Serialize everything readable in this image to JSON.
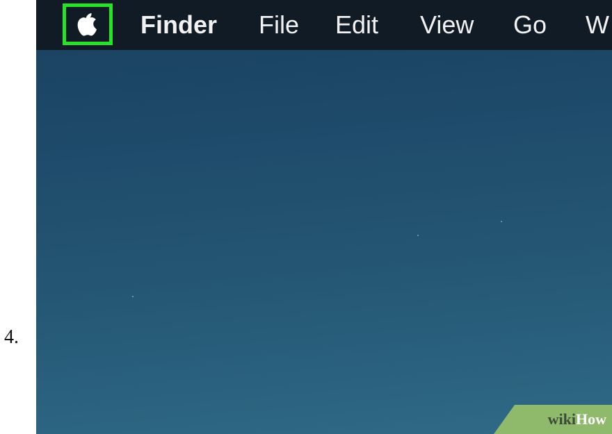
{
  "step": {
    "number": "4."
  },
  "menubar": {
    "apple_icon": "apple-logo-icon",
    "highlight_color": "#27e22a",
    "items": [
      {
        "label": "Finder"
      },
      {
        "label": "File"
      },
      {
        "label": "Edit"
      },
      {
        "label": "View"
      },
      {
        "label": "Go"
      },
      {
        "label": "W"
      }
    ]
  },
  "watermark": {
    "part1": "wiki",
    "part2": "How"
  }
}
